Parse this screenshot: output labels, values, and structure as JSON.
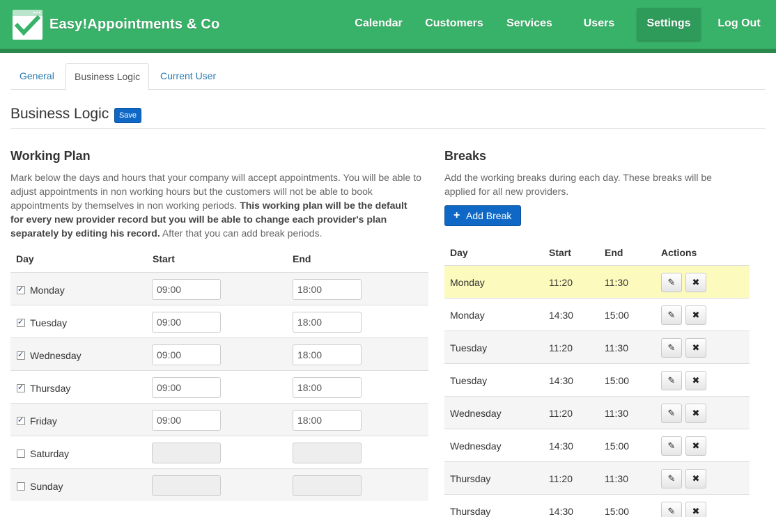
{
  "app": {
    "brand": "Easy!Appointments & Co",
    "colors": {
      "header": "#39b269",
      "accent": "#0f68c6",
      "highlight_row": "#fcfabd"
    }
  },
  "nav": {
    "calendar": "Calendar",
    "customers": "Customers",
    "services": "Services",
    "users": "Users",
    "settings": "Settings",
    "logout": "Log Out",
    "active": "Settings"
  },
  "tabs": {
    "general": "General",
    "business_logic": "Business Logic",
    "current_user": "Current User",
    "active": "Business Logic"
  },
  "page": {
    "title": "Business Logic",
    "save": "Save"
  },
  "working_plan": {
    "heading": "Working Plan",
    "desc_1": "Mark below the days and hours that your company will accept appointments. You will be able to",
    "desc_2": "adjust appointments in non working hours but the customers will not be able to book",
    "desc_3": "appointments by themselves in non working periods.",
    "desc_3b": "This working plan will be the default",
    "desc_4b": "for every new provider record but you will be able to change each provider's plan",
    "desc_5b": "separately by editing his record.",
    "desc_5": "After that you can add break periods.",
    "col_day": "Day",
    "col_start": "Start",
    "col_end": "End",
    "rows": [
      {
        "day": "Monday",
        "checked": true,
        "start": "09:00",
        "end": "18:00"
      },
      {
        "day": "Tuesday",
        "checked": true,
        "start": "09:00",
        "end": "18:00"
      },
      {
        "day": "Wednesday",
        "checked": true,
        "start": "09:00",
        "end": "18:00"
      },
      {
        "day": "Thursday",
        "checked": true,
        "start": "09:00",
        "end": "18:00"
      },
      {
        "day": "Friday",
        "checked": true,
        "start": "09:00",
        "end": "18:00"
      },
      {
        "day": "Saturday",
        "checked": false,
        "start": "",
        "end": ""
      },
      {
        "day": "Sunday",
        "checked": false,
        "start": "",
        "end": ""
      }
    ]
  },
  "breaks": {
    "heading": "Breaks",
    "desc_1": "Add the working breaks during each day. These breaks will be",
    "desc_2": "applied for all new providers.",
    "add_label": "Add Break",
    "add_icon": "plus-icon",
    "col_day": "Day",
    "col_start": "Start",
    "col_end": "End",
    "col_actions": "Actions",
    "edit_icon": "pencil-icon",
    "delete_icon": "close-icon",
    "rows": [
      {
        "day": "Monday",
        "start": "11:20",
        "end": "11:30"
      },
      {
        "day": "Monday",
        "start": "14:30",
        "end": "15:00"
      },
      {
        "day": "Tuesday",
        "start": "11:20",
        "end": "11:30"
      },
      {
        "day": "Tuesday",
        "start": "14:30",
        "end": "15:00"
      },
      {
        "day": "Wednesday",
        "start": "11:20",
        "end": "11:30"
      },
      {
        "day": "Wednesday",
        "start": "14:30",
        "end": "15:00"
      },
      {
        "day": "Thursday",
        "start": "11:20",
        "end": "11:30"
      },
      {
        "day": "Thursday",
        "start": "14:30",
        "end": "15:00"
      }
    ]
  }
}
